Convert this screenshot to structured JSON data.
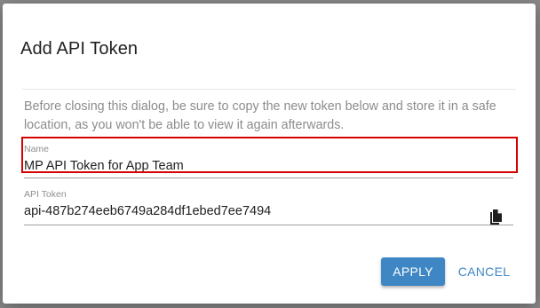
{
  "dialog": {
    "title": "Add API Token",
    "message": "Before closing this dialog, be sure to copy the new token below and store it in a safe location, as you won't be able to view it again afterwards.",
    "name_field": {
      "label": "Name",
      "value": "MP API Token for App Team"
    },
    "token_field": {
      "label": "API Token",
      "value": "api-487b274eeb6749a284df1ebed7ee7494",
      "copy_icon": "copy-icon"
    },
    "buttons": {
      "apply_label": "APPLY",
      "cancel_label": "CANCEL"
    }
  },
  "colors": {
    "accent": "#3f87c4",
    "highlight": "#d50000",
    "overlay": "#8a8a8a"
  }
}
